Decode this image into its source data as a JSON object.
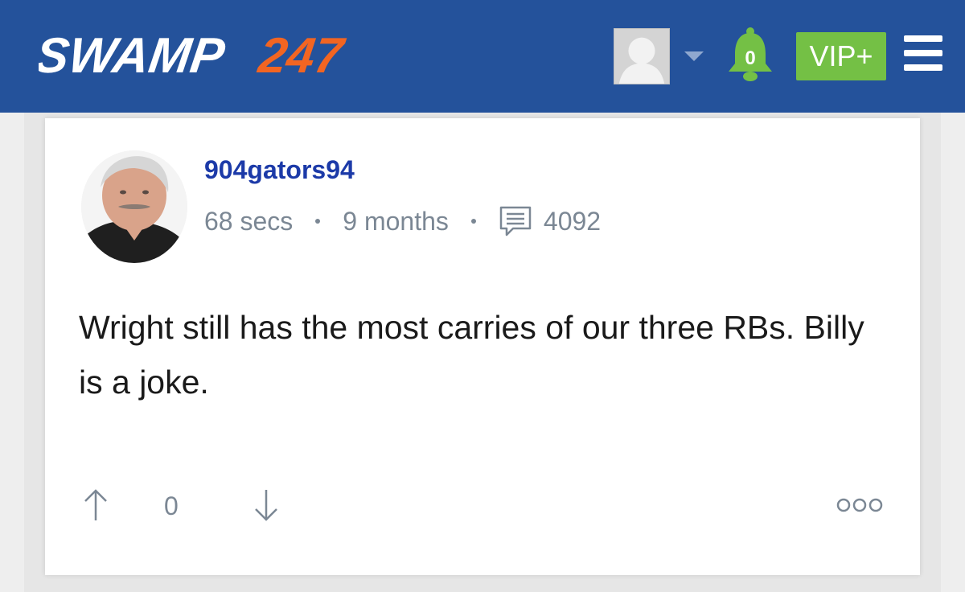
{
  "header": {
    "logo": {
      "text_main": "SWAMP",
      "text_number": "247"
    },
    "notifications": {
      "count": "0",
      "icon": "bell-icon"
    },
    "vip_label": "VIP+",
    "menu_icon": "hamburger-icon",
    "avatar_icon": "default-avatar-icon",
    "dropdown_icon": "caret-down-icon"
  },
  "post": {
    "username": "904gators94",
    "meta": {
      "post_time": "68 secs",
      "member_since": "9 months",
      "post_count": "4092",
      "post_count_icon": "message-icon"
    },
    "body": "Wright still has the most carries of our three RBs. Billy is a joke.",
    "votes": {
      "count": "0",
      "up_icon": "arrow-up-icon",
      "down_icon": "arrow-down-icon"
    },
    "more_icon": "more-options-icon"
  },
  "colors": {
    "header_bg": "#24529b",
    "logo_white": "#ffffff",
    "logo_orange": "#f26522",
    "vip_green": "#74c045",
    "bell_green": "#74c045",
    "username_blue": "#1c3aa8",
    "meta_gray": "#7b8794",
    "page_bg": "#eeeeee"
  }
}
